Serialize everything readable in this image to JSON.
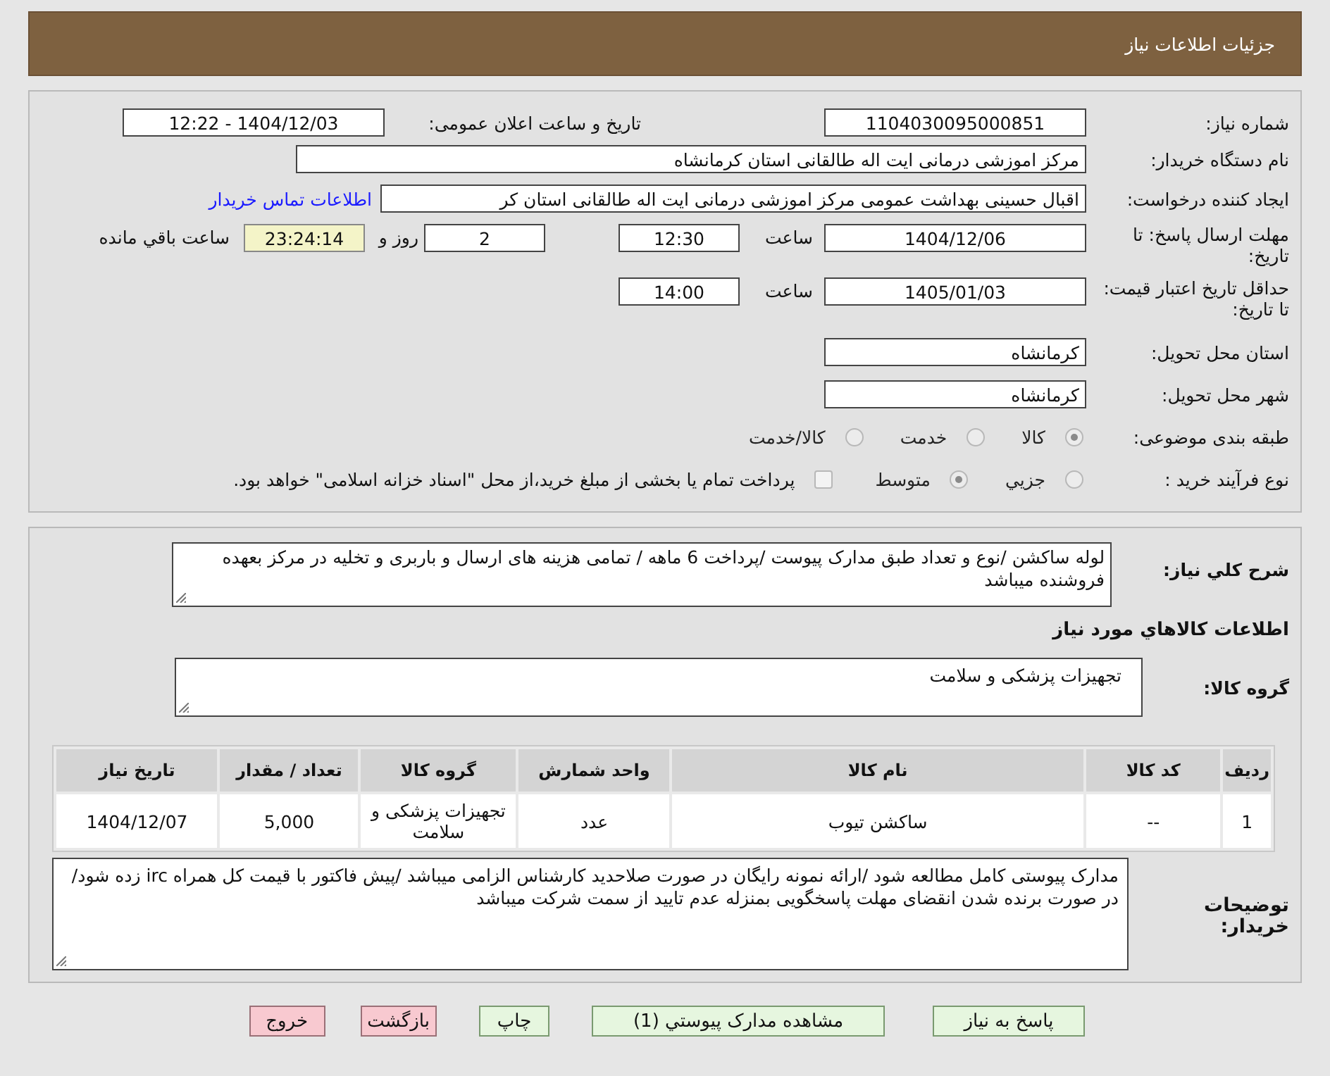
{
  "header": {
    "title": "جزئیات اطلاعات نیاز"
  },
  "need_number": {
    "label": "شماره نیاز:",
    "value": "1104030095000851"
  },
  "announce": {
    "label": "تاریخ و ساعت اعلان عمومی:",
    "value": "1404/12/03 - 12:22"
  },
  "buyer": {
    "label": "نام دستگاه خریدار:",
    "value": "مرکز اموزشی درمانی ایت اله طالقانی استان کرمانشاه"
  },
  "requester": {
    "label": "ایجاد کننده درخواست:",
    "value": "اقبال حسینی بهداشت عمومی مرکز اموزشی درمانی ایت اله طالقانی استان کر",
    "link": "اطلاعات تماس خریدار"
  },
  "deadline": {
    "label": "مهلت ارسال پاسخ: تا تاریخ:",
    "date": "1404/12/06",
    "time_label": "ساعت",
    "time": "12:30",
    "days": "2",
    "days_label": "روز و",
    "remaining": "23:24:14",
    "remaining_label": "ساعت باقي مانده"
  },
  "validity": {
    "label": "حداقل تاریخ اعتبار قیمت: تا تاریخ:",
    "date": "1405/01/03",
    "time_label": "ساعت",
    "time": "14:00"
  },
  "province": {
    "label": "استان محل تحویل:",
    "value": "کرمانشاه"
  },
  "city": {
    "label": "شهر محل تحویل:",
    "value": "کرمانشاه"
  },
  "category": {
    "label": "طبقه بندی موضوعی:",
    "options": [
      {
        "label": "کالا",
        "selected": true
      },
      {
        "label": "خدمت",
        "selected": false
      },
      {
        "label": "کالا/خدمت",
        "selected": false
      }
    ]
  },
  "process": {
    "label": "نوع فرآیند خرید :",
    "options": [
      {
        "label": "جزيي",
        "selected": false
      },
      {
        "label": "متوسط",
        "selected": true
      }
    ],
    "payment": {
      "checked": false,
      "text": "پرداخت تمام یا بخشی از مبلغ خرید،از محل \"اسناد خزانه اسلامی\" خواهد بود."
    }
  },
  "description": {
    "label": "شرح کلي نیاز:",
    "value": "لوله ساکشن /نوع و تعداد طبق مدارک پیوست /پرداخت 6 ماهه / تمامی هزینه های ارسال و باربری و تخلیه در مرکز بعهده فروشنده میباشد"
  },
  "goods_heading": "اطلاعات کالاهاي مورد نیاز",
  "goods_group": {
    "label": "گروه کالا:",
    "value": "تجهیزات پزشکی و سلامت"
  },
  "table": {
    "columns": [
      "ردیف",
      "کد کالا",
      "نام کالا",
      "واحد شمارش",
      "گروه کالا",
      "تعداد / مقدار",
      "تاریخ نیاز"
    ],
    "rows": [
      [
        "1",
        "--",
        "ساکشن تیوب",
        "عدد",
        "تجهیزات پزشکی و سلامت",
        "5,000",
        "1404/12/07"
      ]
    ]
  },
  "buyer_notes": {
    "label": "توضیحات خریدار:",
    "value": "مدارک پیوستی کامل مطالعه شود /ارائه نمونه رایگان در صورت صلاحدید کارشناس الزامی میباشد /پیش فاکتور با قیمت کل همراه irc  زده شود/در صورت برنده شدن انقضای مهلت پاسخگویی بمنزله عدم تایید از سمت شرکت میباشد"
  },
  "buttons": [
    {
      "label": "پاسخ به نیاز",
      "kind": "normal"
    },
    {
      "label": "مشاهده مدارک پیوستي (1)",
      "kind": "normal"
    },
    {
      "label": "چاپ",
      "kind": "normal"
    },
    {
      "label": "بازگشت",
      "kind": "danger"
    },
    {
      "label": "خروج",
      "kind": "danger"
    }
  ]
}
